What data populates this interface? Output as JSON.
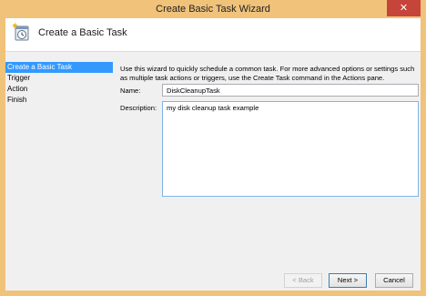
{
  "window": {
    "title": "Create Basic Task Wizard",
    "close_glyph": "✕"
  },
  "header": {
    "icon": "task-scheduler-icon",
    "title": "Create a Basic Task"
  },
  "steps": [
    {
      "label": "Create a Basic Task",
      "active": true
    },
    {
      "label": "Trigger",
      "active": false
    },
    {
      "label": "Action",
      "active": false
    },
    {
      "label": "Finish",
      "active": false
    }
  ],
  "content": {
    "intro": "Use this wizard to quickly schedule a common task.  For more advanced options or settings such as multiple task actions or triggers, use the Create Task command in the Actions pane.",
    "name_label": "Name:",
    "name_value": "DiskCleanupTask",
    "description_label": "Description:",
    "description_value": "my disk cleanup task example"
  },
  "buttons": {
    "back": "< Back",
    "next": "Next >",
    "cancel": "Cancel"
  },
  "colors": {
    "frame": "#f0c27a",
    "close": "#c7443a",
    "selection": "#3399ff"
  }
}
